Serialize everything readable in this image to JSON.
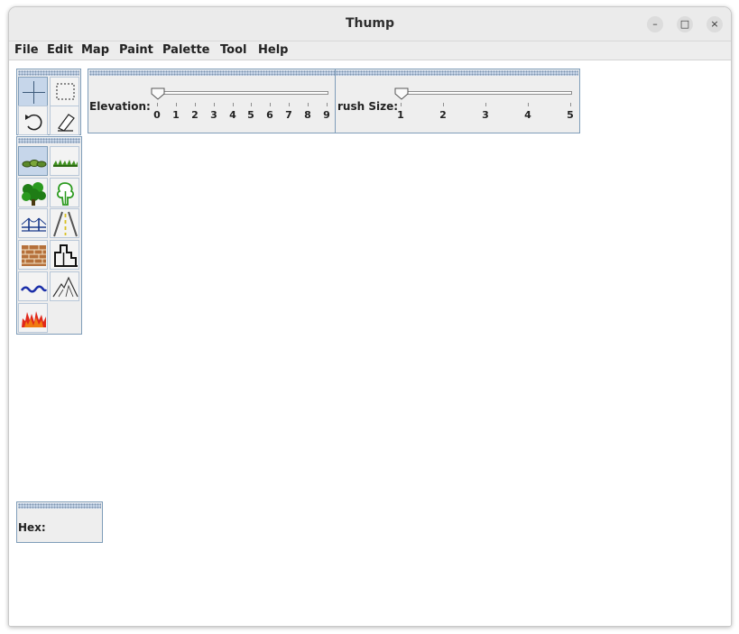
{
  "window": {
    "title": "Thump",
    "controls": {
      "minimize": "–",
      "maximize": "□",
      "close": "×"
    }
  },
  "menubar": {
    "items": [
      "File",
      "Edit",
      "Map",
      "Paint",
      "Palette",
      "Tool",
      "Help"
    ]
  },
  "tools": [
    {
      "name": "crosshair-tool"
    },
    {
      "name": "select-rectangle-tool"
    },
    {
      "name": "undo-tool"
    },
    {
      "name": "eraser-tool"
    }
  ],
  "terrain": [
    {
      "name": "shrub-tile"
    },
    {
      "name": "grass-tile"
    },
    {
      "name": "forest-tile"
    },
    {
      "name": "tree-tile"
    },
    {
      "name": "bridge-tile"
    },
    {
      "name": "road-tile"
    },
    {
      "name": "brick-wall-tile"
    },
    {
      "name": "building-tile"
    },
    {
      "name": "water-tile"
    },
    {
      "name": "mountain-tile"
    },
    {
      "name": "fire-tile"
    }
  ],
  "elevation": {
    "label": "Elevation:",
    "ticks": [
      "0",
      "1",
      "2",
      "3",
      "4",
      "5",
      "6",
      "7",
      "8",
      "9"
    ],
    "value": 0,
    "min": 0,
    "max": 9
  },
  "brush": {
    "label": "rush Size:",
    "ticks": [
      "1",
      "2",
      "3",
      "4",
      "5"
    ],
    "value": 1,
    "min": 1,
    "max": 5
  },
  "hex_panel": {
    "label": "Hex:",
    "value": ""
  },
  "colors": {
    "selected_tool_bg": "#c6d6ea",
    "panel_border": "#7f9db9",
    "menu_bg": "#ededed"
  }
}
